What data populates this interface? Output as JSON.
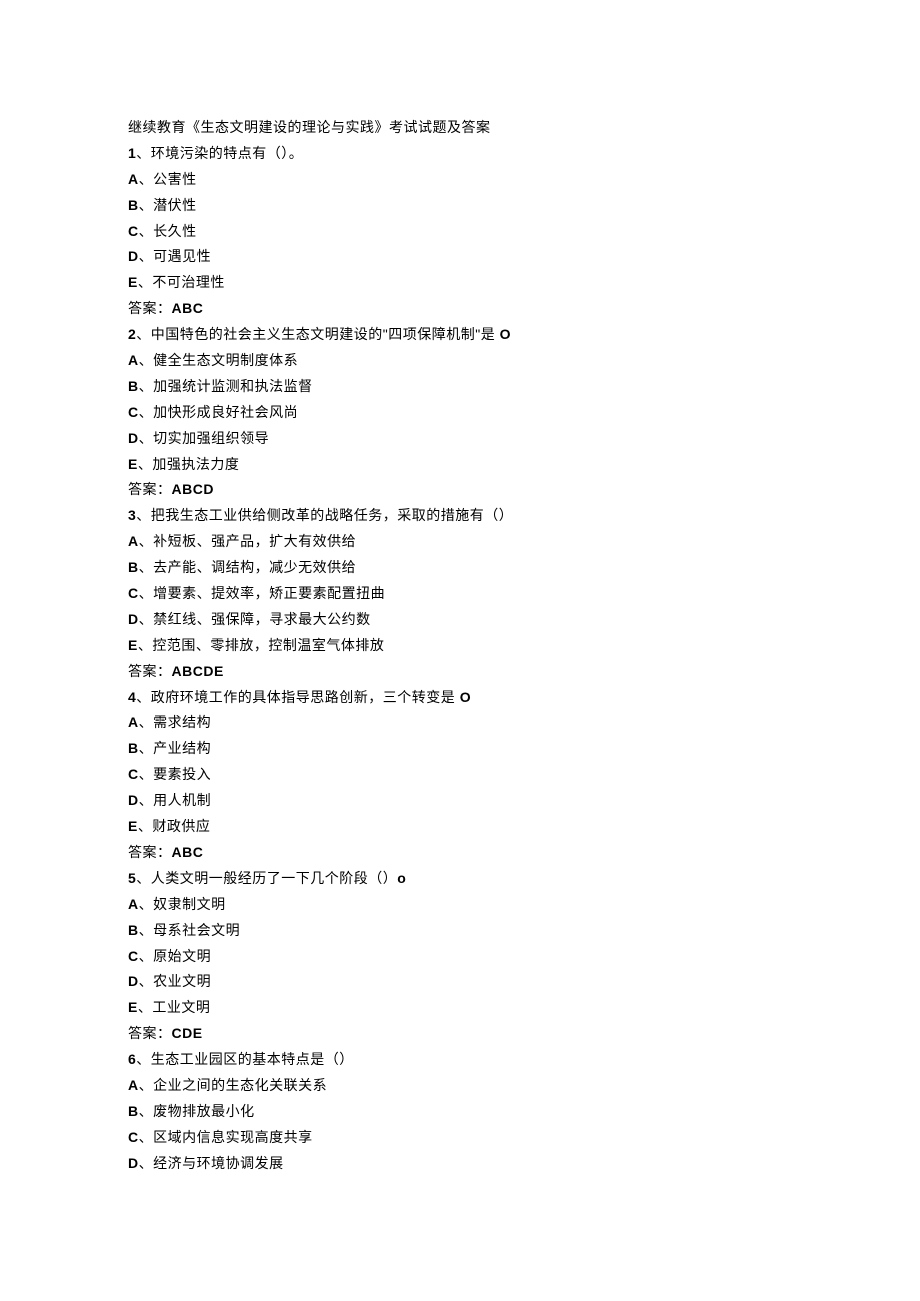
{
  "title": "继续教育《生态文明建设的理论与实践》考试试题及答案",
  "questions": [
    {
      "num": "1",
      "text": "、环境污染的特点有（）。",
      "options": [
        {
          "letter": "A",
          "text": "、公害性"
        },
        {
          "letter": "B",
          "text": "、潜伏性"
        },
        {
          "letter": "C",
          "text": "、长久性"
        },
        {
          "letter": "D",
          "text": "、可遇见性"
        },
        {
          "letter": "E",
          "text": "、不可治理性"
        }
      ],
      "answerLabel": "答案：",
      "answer": "ABC"
    },
    {
      "num": "2",
      "text": "、中国特色的社会主义生态文明建设的\"四项保障机制\"是 ",
      "suffix": "O",
      "options": [
        {
          "letter": "A",
          "text": "、健全生态文明制度体系"
        },
        {
          "letter": "B",
          "text": "、加强统计监测和执法监督"
        },
        {
          "letter": "C",
          "text": "、加快形成良好社会风尚"
        },
        {
          "letter": "D",
          "text": "、切实加强组织领导"
        },
        {
          "letter": "E",
          "text": "、加强执法力度"
        }
      ],
      "answerLabel": "答案：",
      "answer": "ABCD"
    },
    {
      "num": "3",
      "text": "、把我生态工业供给侧改革的战略任务，采取的措施有（）",
      "options": [
        {
          "letter": "A",
          "text": "、补短板、强产品，扩大有效供给"
        },
        {
          "letter": "B",
          "text": "、去产能、调结构，减少无效供给"
        },
        {
          "letter": "C",
          "text": "、增要素、提效率，矫正要素配置扭曲"
        },
        {
          "letter": "D",
          "text": "、禁红线、强保障，寻求最大公约数"
        },
        {
          "letter": "E",
          "text": "、控范围、零排放，控制温室气体排放"
        }
      ],
      "answerLabel": "答案：",
      "answer": "ABCDE"
    },
    {
      "num": "4",
      "text": "、政府环境工作的具体指导思路创新，三个转变是 ",
      "suffix": "O",
      "options": [
        {
          "letter": "A",
          "text": "、需求结构"
        },
        {
          "letter": "B",
          "text": "、产业结构"
        },
        {
          "letter": "C",
          "text": "、要素投入"
        },
        {
          "letter": "D",
          "text": "、用人机制"
        },
        {
          "letter": "E",
          "text": "、财政供应"
        }
      ],
      "answerLabel": "答案：",
      "answer": "ABC"
    },
    {
      "num": "5",
      "text": "、人类文明一般经历了一下几个阶段（）",
      "suffix": "o",
      "options": [
        {
          "letter": "A",
          "text": "、奴隶制文明"
        },
        {
          "letter": "B",
          "text": "、母系社会文明"
        },
        {
          "letter": "C",
          "text": "、原始文明"
        },
        {
          "letter": "D",
          "text": "、农业文明"
        },
        {
          "letter": "E",
          "text": "、工业文明"
        }
      ],
      "answerLabel": "答案：",
      "answer": "CDE"
    },
    {
      "num": "6",
      "text": "、生态工业园区的基本特点是（）",
      "options": [
        {
          "letter": "A",
          "text": "、企业之间的生态化关联关系"
        },
        {
          "letter": "B",
          "text": "、废物排放最小化"
        },
        {
          "letter": "C",
          "text": "、区域内信息实现高度共享"
        },
        {
          "letter": "D",
          "text": "、经济与环境协调发展"
        }
      ]
    }
  ]
}
